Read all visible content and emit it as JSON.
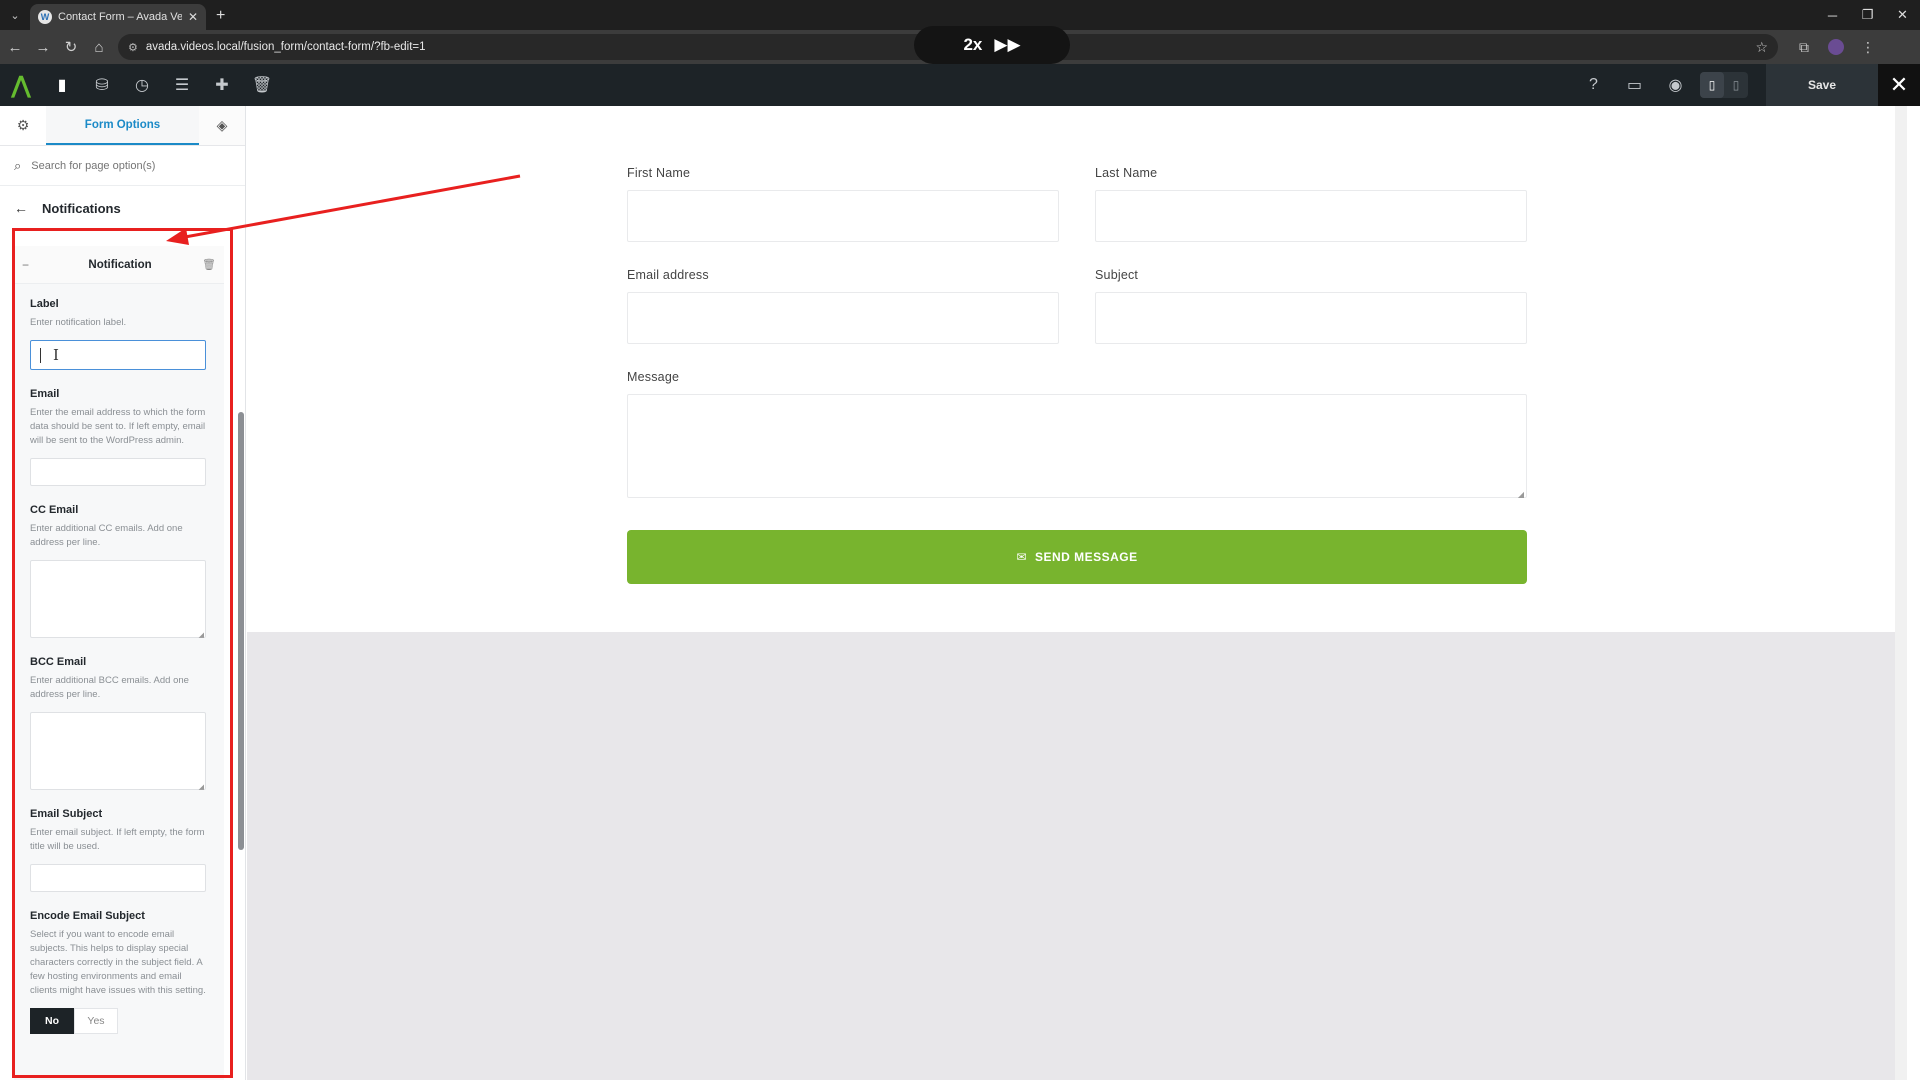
{
  "browser": {
    "tab_title": "Contact Form – Avada Vegan St",
    "tab_favicon": "W",
    "tab_list_icon": "⌄",
    "tab_close_icon": "✕",
    "new_tab_icon": "+",
    "url": "avada.videos.local/fusion_form/contact-form/?fb-edit=1",
    "win_minimize": "─",
    "win_restore": "❐",
    "win_close": "✕",
    "back_icon": "←",
    "forward_icon": "→",
    "reload_icon": "↻",
    "home_icon": "⌂",
    "site_info_icon": "⚙",
    "star_icon": "☆",
    "extensions_icon": "⧉",
    "menu_icon": "⋮"
  },
  "overlay": {
    "speed_label": "2x",
    "speed_icon": "▶▶"
  },
  "toolbar": {
    "logo_icon": "⋀",
    "buttons": [
      "▮",
      "⛁",
      "◷",
      "☰",
      "✚",
      "🗑"
    ],
    "help_icon": "?",
    "desktop_icon": "▭",
    "preview_icon": "◉",
    "device_page_icon": "▯",
    "device_blank_icon": "▯",
    "save_label": "Save",
    "close_icon": "✕"
  },
  "sidebar": {
    "settings_icon": "⚙",
    "active_tab": "Form Options",
    "layers_icon": "◈",
    "search_icon": "⌕",
    "search_placeholder": "Search for page option(s)",
    "back_icon": "←",
    "section_title": "Notifications",
    "notification": {
      "collapse_icon": "−",
      "title": "Notification",
      "trash_icon": "🗑",
      "fields": {
        "label": {
          "label": "Label",
          "desc": "Enter notification label.",
          "cursor_icon": "I"
        },
        "email": {
          "label": "Email",
          "desc": "Enter the email address to which the form data should be sent to. If left empty, email will be sent to the WordPress admin."
        },
        "cc": {
          "label": "CC Email",
          "desc": "Enter additional CC emails. Add one address per line."
        },
        "bcc": {
          "label": "BCC Email",
          "desc": "Enter additional BCC emails. Add one address per line."
        },
        "subject": {
          "label": "Email Subject",
          "desc": "Enter email subject. If left empty, the form title will be used."
        },
        "encode": {
          "label": "Encode Email Subject",
          "desc": "Select if you want to encode email subjects. This helps to display special characters correctly in the subject field. A few hosting environments and email clients might have issues with this setting.",
          "options": [
            "No",
            "Yes"
          ],
          "selected": "No"
        }
      }
    }
  },
  "annotation": {
    "color": "#e8201f"
  },
  "form": {
    "first_name_label": "First Name",
    "last_name_label": "Last Name",
    "email_label": "Email address",
    "subject_label": "Subject",
    "message_label": "Message",
    "send_icon": "✉",
    "send_label": "SEND MESSAGE",
    "button_color": "#78b42e"
  }
}
